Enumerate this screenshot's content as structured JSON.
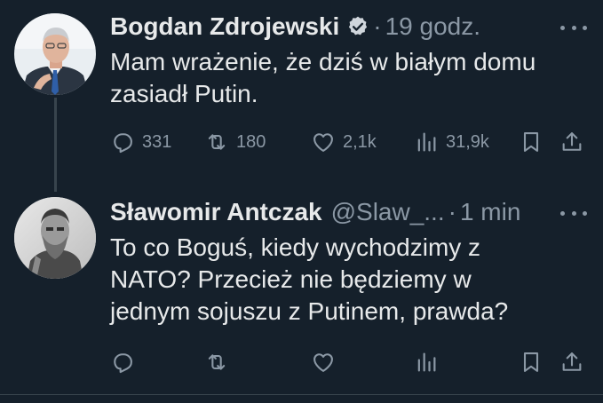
{
  "tweets": [
    {
      "author": {
        "name": "Bogdan Zdrojewski",
        "verified": true,
        "handle": ""
      },
      "time": "19 godz.",
      "text": "Mam wrażenie, że dziś w białym domu\nzasiadł Putin.",
      "stats": {
        "replies": "331",
        "retweets": "180",
        "likes": "2,1k",
        "views": "31,9k"
      }
    },
    {
      "author": {
        "name": "Sławomir Antczak",
        "verified": false,
        "handle": "@Slaw_..."
      },
      "time": "1 min",
      "text": "To co Boguś, kiedy wychodzimy z\nNATO? Przecież nie będziemy w\njednym sojuszu z Putinem, prawda?",
      "stats": {
        "replies": "",
        "retweets": "",
        "likes": "",
        "views": ""
      }
    }
  ],
  "separator": "·",
  "colors": {
    "background": "#15202b",
    "text": "#e7e9ea",
    "muted": "#8b98a5",
    "verified_badge": "#d0d6dc",
    "thread_line": "#38444d"
  },
  "icons": [
    "reply-icon",
    "retweet-icon",
    "like-icon",
    "views-icon",
    "bookmark-icon",
    "share-icon",
    "verified-badge-icon",
    "more-icon"
  ]
}
